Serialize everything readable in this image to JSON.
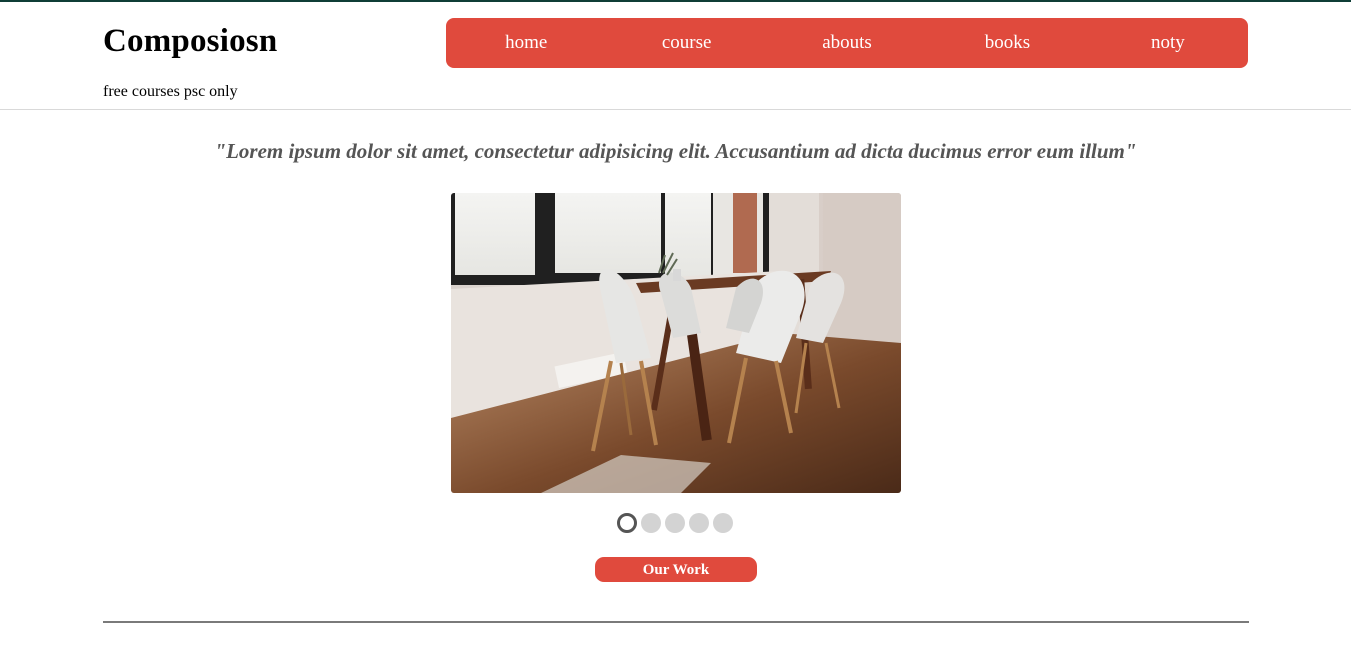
{
  "brand": {
    "title": "Composiosn",
    "tagline": "free courses psc only"
  },
  "nav": {
    "items": [
      {
        "label": "home"
      },
      {
        "label": "course"
      },
      {
        "label": "abouts"
      },
      {
        "label": "books"
      },
      {
        "label": "noty"
      }
    ]
  },
  "hero": {
    "quote": "\"Lorem ipsum dolor sit amet, consectetur adipisicing elit. Accusantium ad dicta ducimus error eum illum\"",
    "slider": {
      "slide_count": 5,
      "active_index": 0
    },
    "cta_label": "Our Work"
  },
  "colors": {
    "accent": "#e04a3d",
    "quote_text": "#555555",
    "dot_inactive": "#d3d3d3",
    "dot_active_ring": "#555555",
    "top_strip": "#0f3d36"
  }
}
